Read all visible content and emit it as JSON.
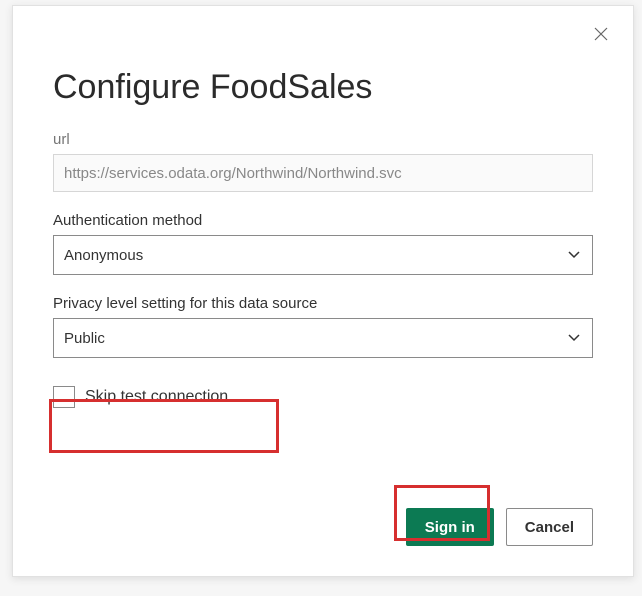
{
  "dialog": {
    "title": "Configure FoodSales",
    "url_label": "url",
    "url_value": "https://services.odata.org/Northwind/Northwind.svc",
    "auth_label": "Authentication method",
    "auth_value": "Anonymous",
    "privacy_label": "Privacy level setting for this data source",
    "privacy_value": "Public",
    "skip_test_label": "Skip test connection",
    "signin_label": "Sign in",
    "cancel_label": "Cancel"
  }
}
